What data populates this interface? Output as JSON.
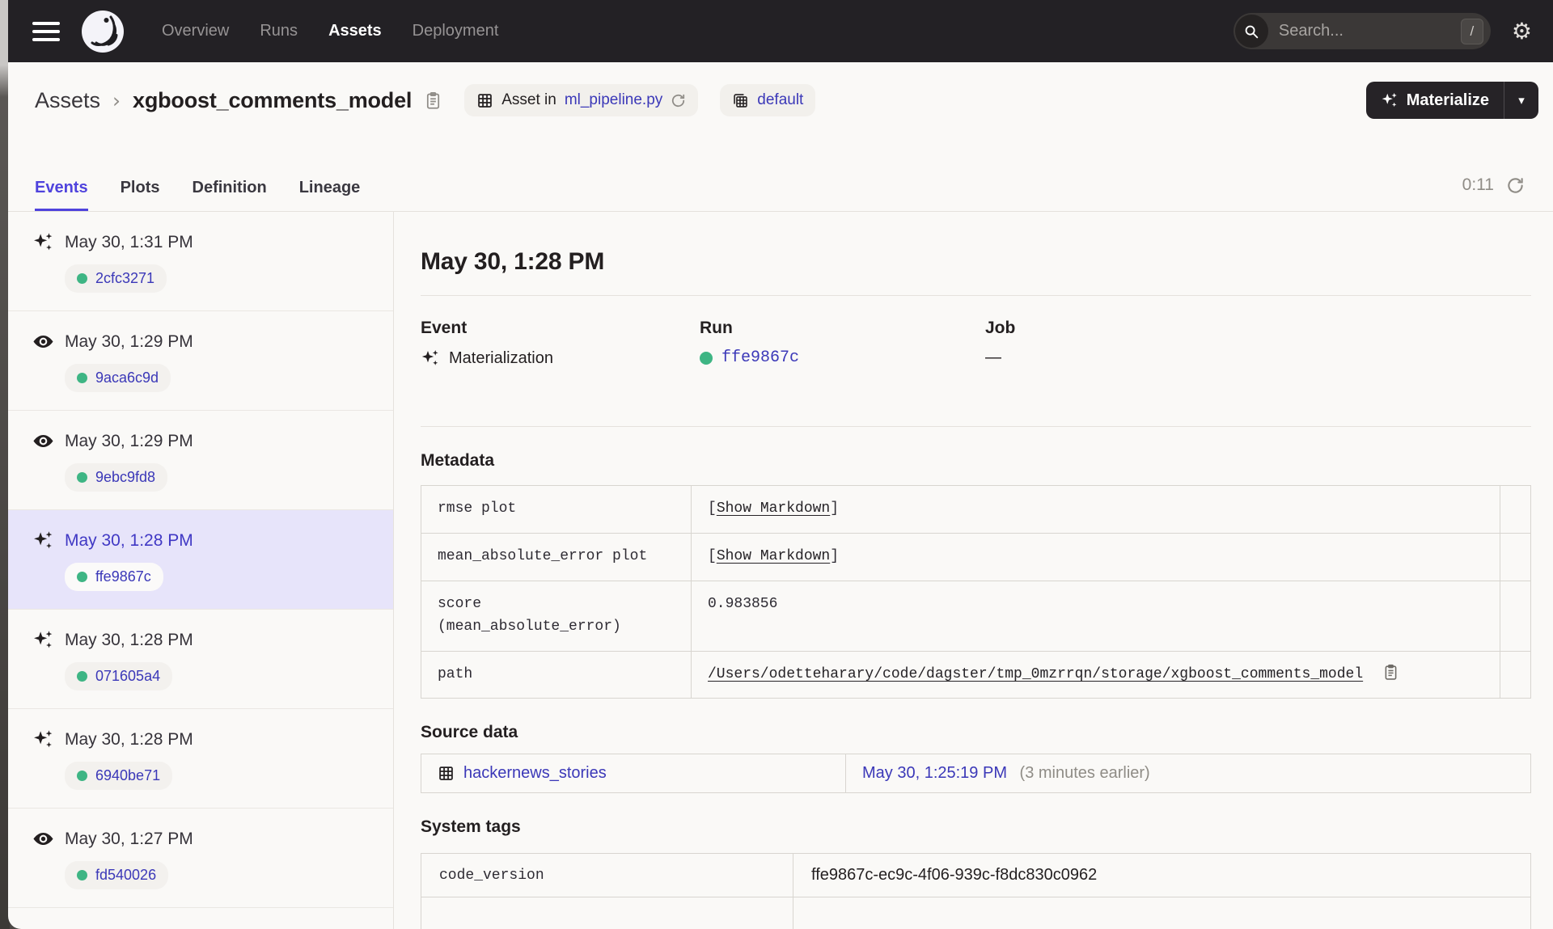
{
  "colors": {
    "accent": "#4F43DD",
    "link": "#3B38B8",
    "status_green": "#3EB584",
    "navbar_bg": "#232125",
    "page_bg": "#FAF9F7",
    "selected_bg": "#E7E4FA"
  },
  "navbar": {
    "items": [
      {
        "label": "Overview",
        "active": false
      },
      {
        "label": "Runs",
        "active": false
      },
      {
        "label": "Assets",
        "active": true
      },
      {
        "label": "Deployment",
        "active": false
      }
    ],
    "search": {
      "placeholder": "Search...",
      "shortcut": "/"
    }
  },
  "breadcrumb": {
    "root": "Assets",
    "separator": "›",
    "asset_name": "xgboost_comments_model",
    "asset_location_prefix": "Asset in",
    "asset_location_file": "ml_pipeline.py",
    "group_badge": "default",
    "materialize_label": "Materialize",
    "caret": "▾"
  },
  "tabs": {
    "items": [
      {
        "label": "Events",
        "active": true
      },
      {
        "label": "Plots",
        "active": false
      },
      {
        "label": "Definition",
        "active": false
      },
      {
        "label": "Lineage",
        "active": false
      }
    ],
    "refresh_timer": "0:11"
  },
  "sidebar": {
    "events": [
      {
        "type": "materialization",
        "time": "May 30, 1:31 PM",
        "run_id": "2cfc3271",
        "selected": false
      },
      {
        "type": "observation",
        "time": "May 30, 1:29 PM",
        "run_id": "9aca6c9d",
        "selected": false
      },
      {
        "type": "observation",
        "time": "May 30, 1:29 PM",
        "run_id": "9ebc9fd8",
        "selected": false
      },
      {
        "type": "materialization",
        "time": "May 30, 1:28 PM",
        "run_id": "ffe9867c",
        "selected": true
      },
      {
        "type": "materialization",
        "time": "May 30, 1:28 PM",
        "run_id": "071605a4",
        "selected": false
      },
      {
        "type": "materialization",
        "time": "May 30, 1:28 PM",
        "run_id": "6940be71",
        "selected": false
      },
      {
        "type": "observation",
        "time": "May 30, 1:27 PM",
        "run_id": "fd540026",
        "selected": false
      }
    ]
  },
  "detail": {
    "title": "May 30, 1:28 PM",
    "overview": {
      "event": {
        "label": "Event",
        "value": "Materialization"
      },
      "run": {
        "label": "Run",
        "value": "ffe9867c"
      },
      "job": {
        "label": "Job",
        "value": "—"
      }
    },
    "metadata": {
      "heading": "Metadata",
      "rows": [
        {
          "key": "rmse plot",
          "link": true,
          "value_prefix": "[",
          "value": "Show Markdown",
          "value_suffix": "]",
          "plain": false,
          "copy": false
        },
        {
          "key": "mean_absolute_error plot",
          "link": true,
          "value_prefix": "[",
          "value": "Show Markdown",
          "value_suffix": "]",
          "plain": false,
          "copy": false
        },
        {
          "key": "score\n(mean_absolute_error)",
          "link": false,
          "plain": true,
          "value": "0.983856",
          "copy": false
        },
        {
          "key": "path",
          "link": true,
          "value_prefix": "",
          "value": "/Users/odetteharary/code/dagster/tmp_0mzrrqn/storage/xgboost_comments_model",
          "value_suffix": "",
          "plain": false,
          "copy": true
        }
      ]
    },
    "source_data": {
      "heading": "Source data",
      "asset_link": "hackernews_stories",
      "timestamp": "May 30, 1:25:19 PM",
      "relative_time": "(3 minutes earlier)"
    },
    "system_tags": {
      "heading": "System tags",
      "rows": [
        {
          "key": "code_version",
          "value": "ffe9867c-ec9c-4f06-939c-f8dc830c0962"
        }
      ]
    }
  }
}
